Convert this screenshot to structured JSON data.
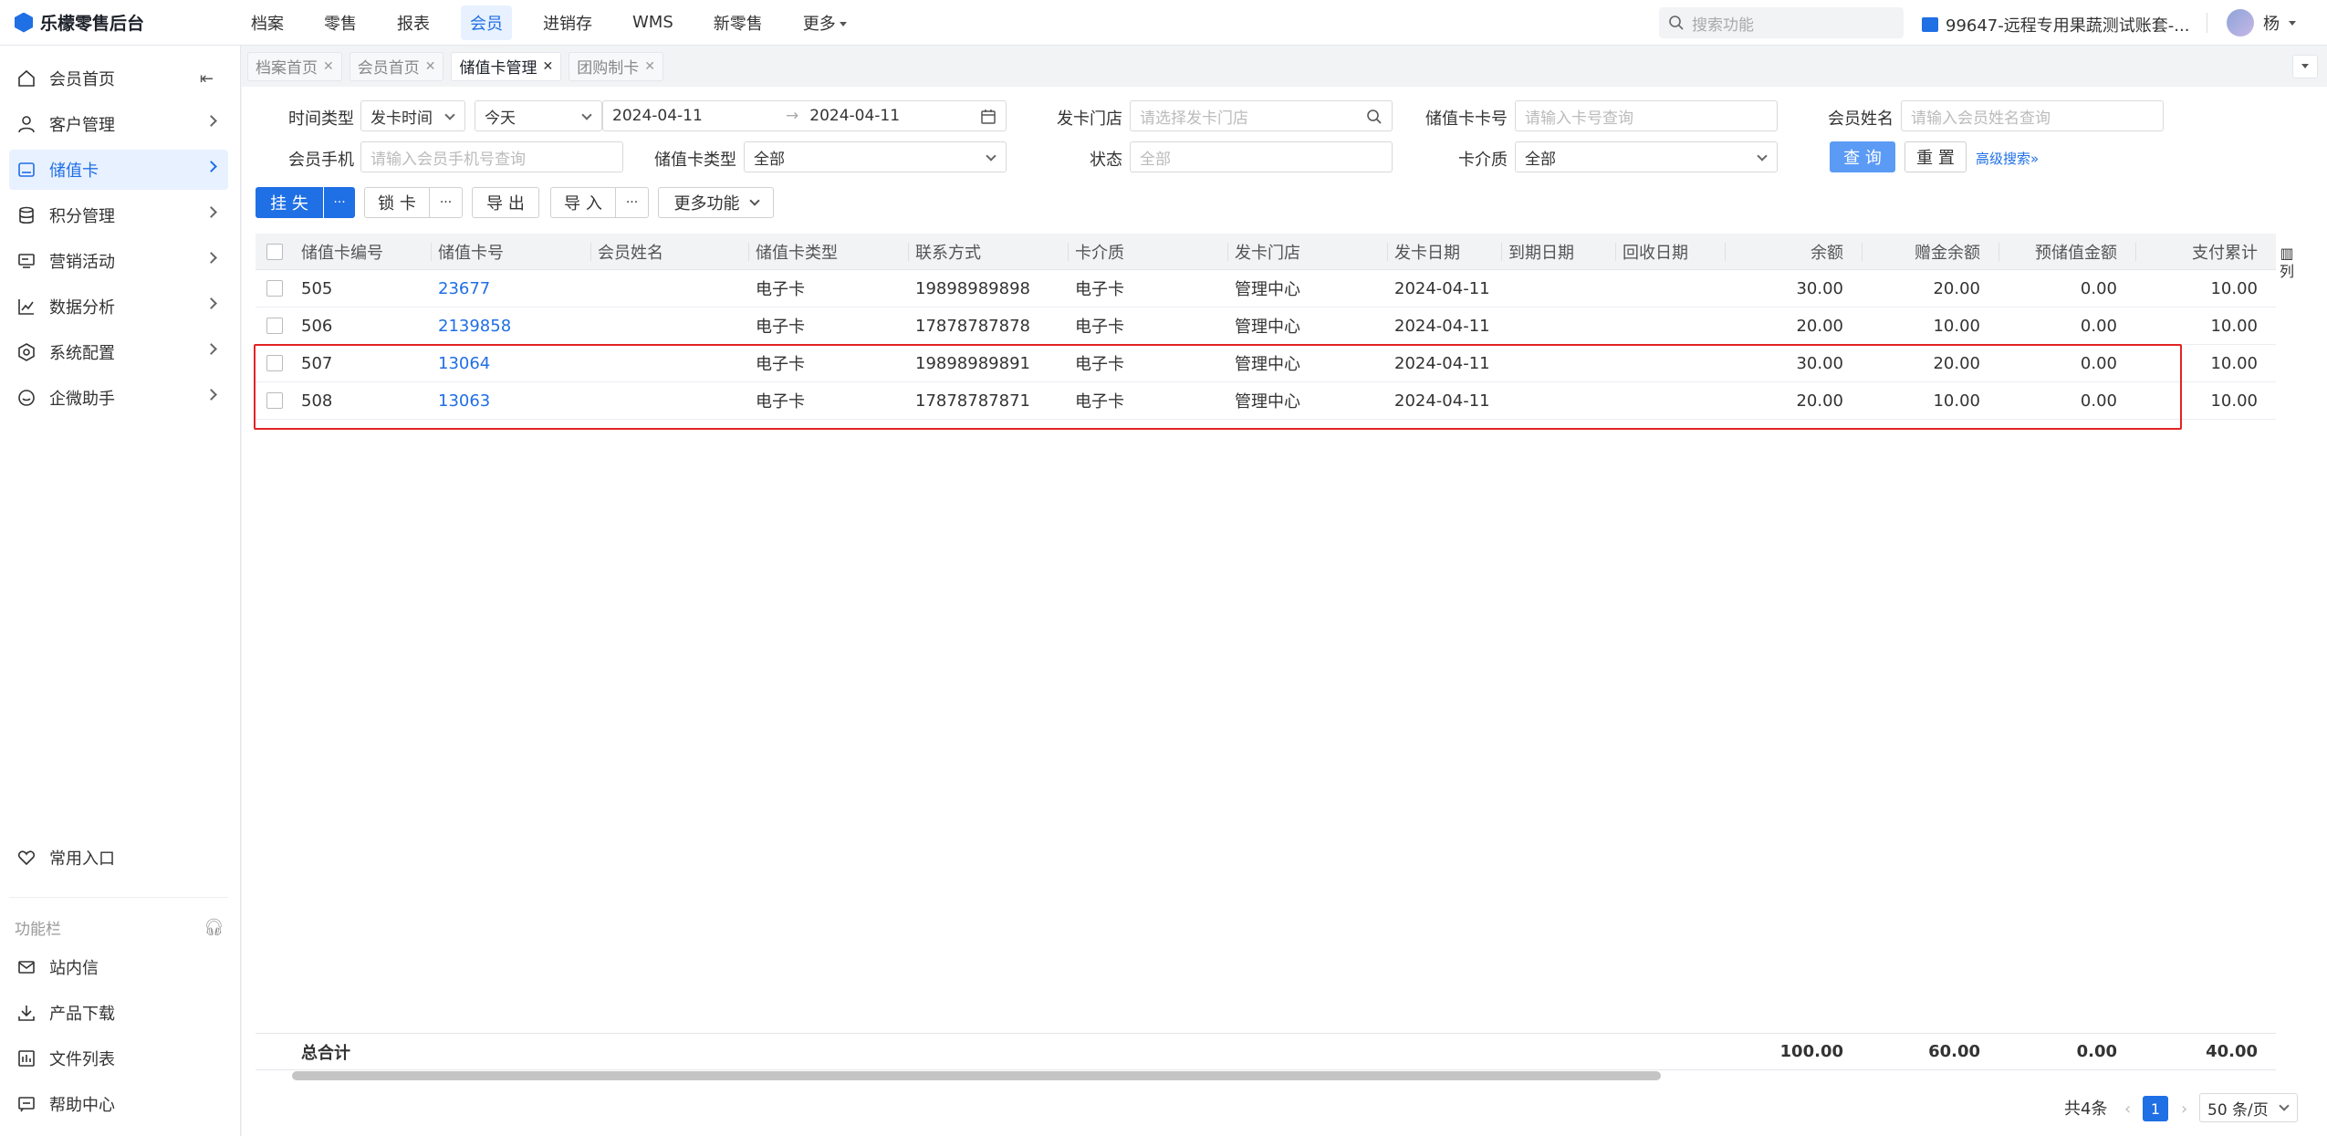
{
  "app": {
    "title": "乐檬零售后台"
  },
  "topnav": [
    "档案",
    "零售",
    "报表",
    "会员",
    "进销存",
    "WMS",
    "新零售",
    "更多"
  ],
  "topnav_active": "会员",
  "search": {
    "placeholder": "搜索功能"
  },
  "account": "99647-远程专用果蔬测试账套-...",
  "user": "杨",
  "sidebar": {
    "items": [
      "会员首页",
      "客户管理",
      "储值卡",
      "积分管理",
      "营销活动",
      "数据分析",
      "系统配置",
      "企微助手"
    ],
    "active": "储值卡",
    "bottom_items": [
      "常用入口"
    ],
    "section_label": "功能栏",
    "tools": [
      "站内信",
      "产品下载",
      "文件列表",
      "帮助中心"
    ]
  },
  "tabs": [
    {
      "label": "档案首页",
      "active": false
    },
    {
      "label": "会员首页",
      "active": false
    },
    {
      "label": "储值卡管理",
      "active": true
    },
    {
      "label": "团购制卡",
      "active": false
    }
  ],
  "filters": {
    "time_type_label": "时间类型",
    "time_type_value": "发卡时间",
    "time_range_value": "今天",
    "date_start": "2024-04-11",
    "date_end": "2024-04-11",
    "store_label": "发卡门店",
    "store_placeholder": "请选择发卡门店",
    "card_no_label": "储值卡卡号",
    "card_no_placeholder": "请输入卡号查询",
    "member_name_label": "会员姓名",
    "member_name_placeholder": "请输入会员姓名查询",
    "phone_label": "会员手机",
    "phone_placeholder": "请输入会员手机号查询",
    "card_type_label": "储值卡类型",
    "card_type_value": "全部",
    "status_label": "状态",
    "status_placeholder": "全部",
    "medium_label": "卡介质",
    "medium_value": "全部",
    "query_btn": "查 询",
    "reset_btn": "重 置",
    "advanced_link": "高级搜索"
  },
  "toolbar": {
    "report_loss": "挂 失",
    "lock_card": "锁 卡",
    "export": "导 出",
    "import": "导 入",
    "more": "更多功能",
    "ellipsis": "···"
  },
  "table": {
    "columns": [
      "储值卡编号",
      "储值卡号",
      "会员姓名",
      "储值卡类型",
      "联系方式",
      "卡介质",
      "发卡门店",
      "发卡日期",
      "到期日期",
      "回收日期",
      "余额",
      "赠金余额",
      "预储值金额",
      "支付累计"
    ],
    "rows": [
      [
        "505",
        "23677",
        "",
        "电子卡",
        "19898989898",
        "电子卡",
        "管理中心",
        "2024-04-11",
        "",
        "",
        "30.00",
        "20.00",
        "0.00",
        "10.00"
      ],
      [
        "506",
        "2139858",
        "",
        "电子卡",
        "17878787878",
        "电子卡",
        "管理中心",
        "2024-04-11",
        "",
        "",
        "20.00",
        "10.00",
        "0.00",
        "10.00"
      ],
      [
        "507",
        "13064",
        "",
        "电子卡",
        "19898989891",
        "电子卡",
        "管理中心",
        "2024-04-11",
        "",
        "",
        "30.00",
        "20.00",
        "0.00",
        "10.00"
      ],
      [
        "508",
        "13063",
        "",
        "电子卡",
        "17878787871",
        "电子卡",
        "管理中心",
        "2024-04-11",
        "",
        "",
        "20.00",
        "10.00",
        "0.00",
        "10.00"
      ]
    ],
    "total_label": "总合计",
    "totals": {
      "balance": "100.00",
      "gift": "60.00",
      "prestore": "0.00",
      "paid": "40.00"
    },
    "column_tool": "列"
  },
  "pagination": {
    "total": "共4条",
    "page": "1",
    "page_size": "50 条/页"
  }
}
